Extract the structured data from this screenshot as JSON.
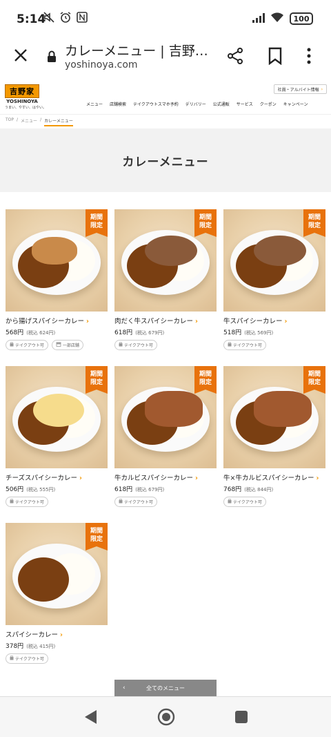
{
  "status_bar": {
    "time": "5:14",
    "battery": "100"
  },
  "url_bar": {
    "page_title": "カレーメニュー | 吉野…",
    "domain": "yoshinoya.com"
  },
  "site": {
    "logo_text": "吉野家",
    "logo_en": "YOSHINOYA",
    "slogan": "うまい、やすい、はやい。",
    "recruit_link": "社員・アルバイト情報",
    "nav": [
      "メニュー",
      "店舗検索",
      "テイクアウトスマホ予約",
      "デリバリー",
      "公式通販",
      "サービス",
      "クーポン",
      "キャンペーン"
    ]
  },
  "breadcrumb": [
    "TOP",
    "メニュー",
    "カレーメニュー"
  ],
  "page_heading": "カレーメニュー",
  "badge_text": "期間\n限定",
  "items": [
    {
      "name": "から揚げスパイシーカレー",
      "price": "568",
      "yen": "円",
      "tax_label": "(税込",
      "tax_price": "624",
      "tax_close": "円)",
      "tags": [
        "テイクアウト可",
        "一部店舗"
      ],
      "limited": true,
      "topping": "karaage"
    },
    {
      "name": "肉だく牛スパイシーカレー",
      "price": "618",
      "yen": "円",
      "tax_label": "(税込",
      "tax_price": "679",
      "tax_close": "円)",
      "tags": [
        "テイクアウト可"
      ],
      "limited": true,
      "topping": "beef"
    },
    {
      "name": "牛スパイシーカレー",
      "price": "518",
      "yen": "円",
      "tax_label": "(税込",
      "tax_price": "569",
      "tax_close": "円)",
      "tags": [
        "テイクアウト可"
      ],
      "limited": true,
      "topping": "beef"
    },
    {
      "name": "チーズスパイシーカレー",
      "price": "506",
      "yen": "円",
      "tax_label": "(税込",
      "tax_price": "555",
      "tax_close": "円)",
      "tags": [
        "テイクアウト可"
      ],
      "limited": true,
      "topping": "cheese"
    },
    {
      "name": "牛カルビスパイシーカレー",
      "price": "618",
      "yen": "円",
      "tax_label": "(税込",
      "tax_price": "679",
      "tax_close": "円)",
      "tags": [
        "テイクアウト可"
      ],
      "limited": true,
      "topping": "kalbi"
    },
    {
      "name": "牛×牛カルビスパイシーカレー",
      "price": "768",
      "yen": "円",
      "tax_label": "(税込",
      "tax_price": "844",
      "tax_close": "円)",
      "tags": [
        "テイクアウト可"
      ],
      "limited": true,
      "topping": "kalbi"
    },
    {
      "name": "スパイシーカレー",
      "price": "378",
      "yen": "円",
      "tax_label": "(税込",
      "tax_price": "415",
      "tax_close": "円)",
      "tags": [
        "テイクアウト可"
      ],
      "limited": true,
      "topping": "none"
    }
  ],
  "all_menu_button": "全てのメニュー",
  "colors": {
    "accent": "#f39800",
    "badge": "#e8720c",
    "curry": "#7a3f12"
  }
}
